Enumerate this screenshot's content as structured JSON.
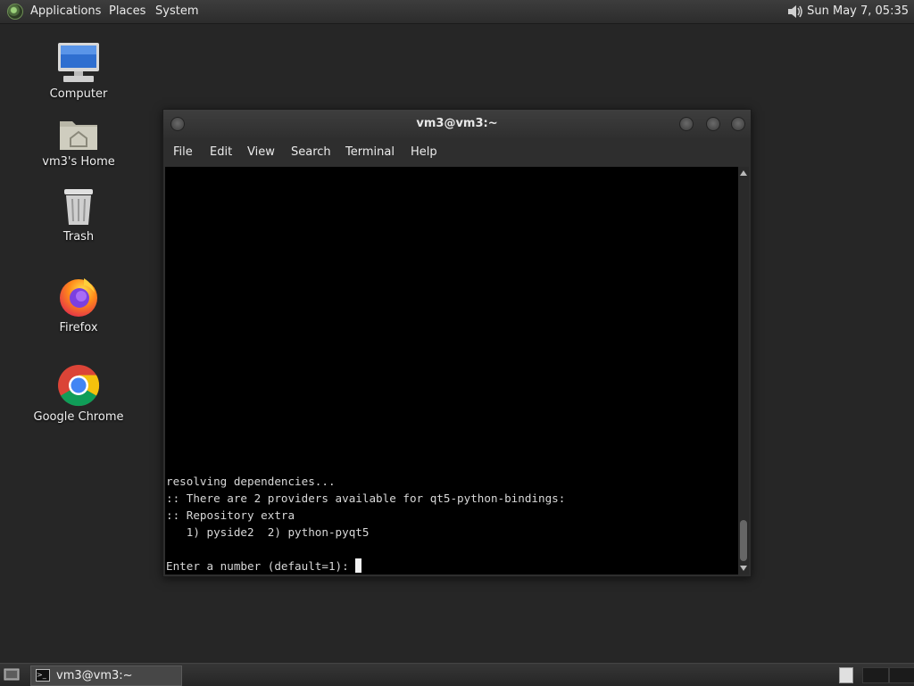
{
  "top_panel": {
    "menus": [
      "Applications",
      "Places",
      "System"
    ],
    "clock": "Sun May  7, 05:35"
  },
  "desktop": {
    "icons": [
      {
        "label": "Computer",
        "icon": "computer-icon"
      },
      {
        "label": "vm3's Home",
        "icon": "home-folder-icon"
      },
      {
        "label": "Trash",
        "icon": "trash-icon"
      },
      {
        "label": "Firefox",
        "icon": "firefox-icon"
      },
      {
        "label": "Google Chrome",
        "icon": "chrome-icon"
      }
    ]
  },
  "window": {
    "title": "vm3@vm3:~",
    "menu": [
      "File",
      "Edit",
      "View",
      "Search",
      "Terminal",
      "Help"
    ],
    "terminal_lines": [
      "resolving dependencies...",
      ":: There are 2 providers available for qt5-python-bindings:",
      ":: Repository extra",
      "   1) pyside2  2) python-pyqt5",
      "",
      "Enter a number (default=1): "
    ]
  },
  "taskbar": {
    "task_label": "vm3@vm3:~"
  },
  "colors": {
    "desktop_bg": "#262626",
    "terminal_bg": "#000000",
    "terminal_fg": "#d8d8d8"
  }
}
